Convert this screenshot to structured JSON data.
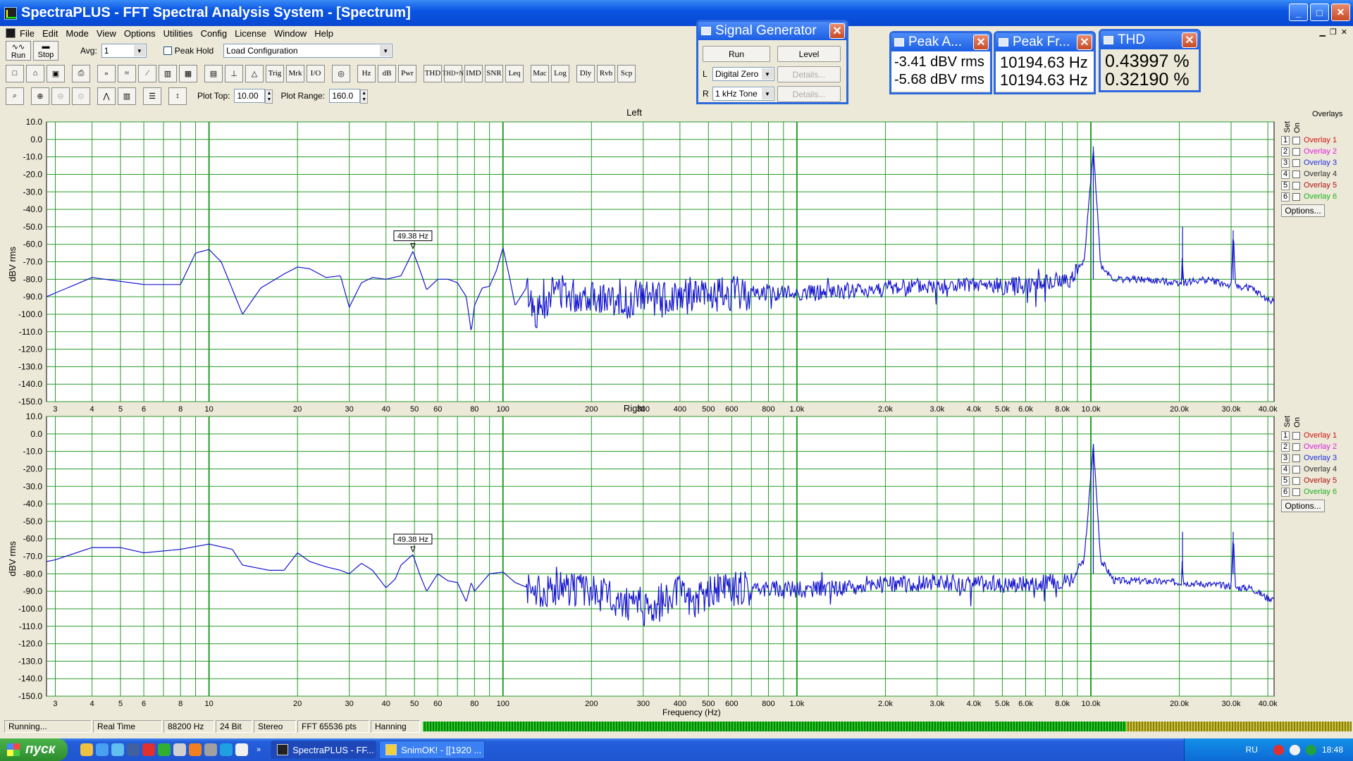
{
  "window": {
    "title": "SpectraPLUS - FFT Spectral Analysis System - [Spectrum]"
  },
  "menu": [
    "File",
    "Edit",
    "Mode",
    "View",
    "Options",
    "Utilities",
    "Config",
    "License",
    "Window",
    "Help"
  ],
  "toolbar1": {
    "run_label": "Run",
    "stop_label": "Stop",
    "avg_label": "Avg:",
    "avg_value": "1",
    "peak_hold_label": "Peak Hold",
    "config_value": "Load Configuration"
  },
  "toolbar2": [
    "Hz",
    "dB",
    "Pwr",
    "THD",
    "THD+N",
    "IMD",
    "SNR",
    "Leq",
    "Mac",
    "Log",
    "Dly",
    "Rvb",
    "Scp"
  ],
  "toolbar3": {
    "plot_top_label": "Plot Top:",
    "plot_top_value": "10.00",
    "plot_range_label": "Plot Range:",
    "plot_range_value": "160.0"
  },
  "signal_generator": {
    "title": "Signal Generator",
    "run": "Run",
    "level": "Level",
    "left_label": "L",
    "left_value": "Digital Zero",
    "right_label": "R",
    "right_value": "1 kHz Tone",
    "details": "Details..."
  },
  "peak_amplitude": {
    "title": "Peak A...",
    "line1": "-3.41 dBV rms",
    "line2": "-5.68 dBV rms"
  },
  "peak_frequency": {
    "title": "Peak Fr...",
    "line1": "10194.63 Hz",
    "line2": "10194.63 Hz"
  },
  "thd": {
    "title": "THD",
    "line1": "0.43997 %",
    "line2": "0.32190 %"
  },
  "plots": [
    {
      "title": "Left",
      "ylabel": "dBV rms",
      "marker": "49.38 Hz"
    },
    {
      "title": "Right",
      "ylabel": "dBV rms",
      "marker": "49.38 Hz"
    }
  ],
  "xlabel": "Frequency (Hz)",
  "overlays": {
    "header": "Overlays",
    "set_label": "Set",
    "on_label": "On",
    "options": "Options...",
    "items": [
      {
        "num": "1",
        "label": "Overlay 1",
        "color": "#d01010"
      },
      {
        "num": "2",
        "label": "Overlay 2",
        "color": "#e020e0"
      },
      {
        "num": "3",
        "label": "Overlay 3",
        "color": "#2030e0"
      },
      {
        "num": "4",
        "label": "Overlay 4",
        "color": "#303030"
      },
      {
        "num": "5",
        "label": "Overlay 5",
        "color": "#b01010"
      },
      {
        "num": "6",
        "label": "Overlay 6",
        "color": "#20b020"
      }
    ]
  },
  "chart_data": [
    {
      "type": "line",
      "title": "Left",
      "xlabel": "Frequency (Hz)",
      "ylabel": "dBV rms",
      "xscale": "log",
      "xlim": [
        2.8,
        42000
      ],
      "ylim": [
        -150,
        10
      ],
      "yticks": [
        "10.0",
        "0.0",
        "-10.0",
        "-20.0",
        "-30.0",
        "-40.0",
        "-50.0",
        "-60.0",
        "-70.0",
        "-80.0",
        "-90.0",
        "-100.0",
        "-110.0",
        "-120.0",
        "-130.0",
        "-140.0",
        "-150.0"
      ],
      "xticks": [
        "3",
        "4",
        "5",
        "6",
        "8",
        "10",
        "20",
        "30",
        "40",
        "50",
        "60",
        "80",
        "100",
        "200",
        "300",
        "400",
        "500",
        "600",
        "800",
        "1.0k",
        "2.0k",
        "3.0k",
        "4.0k",
        "5.0k",
        "6.0k",
        "8.0k",
        "10.0k",
        "20.0k",
        "30.0k",
        "40.0k"
      ],
      "series": [
        {
          "color": "#1515d0",
          "points": [
            [
              2.8,
              -90
            ],
            [
              4,
              -79
            ],
            [
              6,
              -83
            ],
            [
              8,
              -83
            ],
            [
              9,
              -65
            ],
            [
              10,
              -63
            ],
            [
              11,
              -70
            ],
            [
              13,
              -100
            ],
            [
              15,
              -85
            ],
            [
              18,
              -77
            ],
            [
              20,
              -73
            ],
            [
              22,
              -74
            ],
            [
              25,
              -79
            ],
            [
              28,
              -78
            ],
            [
              30,
              -96
            ],
            [
              33,
              -82
            ],
            [
              36,
              -79
            ],
            [
              40,
              -80
            ],
            [
              45,
              -78
            ],
            [
              49.4,
              -64
            ],
            [
              52,
              -74
            ],
            [
              55,
              -86
            ],
            [
              60,
              -80
            ],
            [
              65,
              -80
            ],
            [
              70,
              -82
            ],
            [
              75,
              -90
            ],
            [
              78,
              -110
            ],
            [
              80,
              -95
            ],
            [
              85,
              -85
            ],
            [
              90,
              -84
            ],
            [
              95,
              -75
            ],
            [
              100,
              -62
            ],
            [
              105,
              -78
            ],
            [
              110,
              -95
            ],
            [
              120,
              -85
            ],
            [
              130,
              -100
            ],
            [
              150,
              -85
            ],
            [
              180,
              -90
            ],
            [
              200,
              -88
            ],
            [
              250,
              -95
            ],
            [
              300,
              -90
            ],
            [
              350,
              -92
            ],
            [
              400,
              -88
            ],
            [
              450,
              -89
            ],
            [
              500,
              -90
            ],
            [
              600,
              -88
            ],
            [
              800,
              -88
            ],
            [
              1000,
              -88
            ],
            [
              1500,
              -87
            ],
            [
              2000,
              -85
            ],
            [
              3000,
              -84
            ],
            [
              5000,
              -84
            ],
            [
              7000,
              -82
            ],
            [
              8500,
              -80
            ],
            [
              9500,
              -70
            ],
            [
              10194,
              -4
            ],
            [
              10800,
              -72
            ],
            [
              12000,
              -80
            ],
            [
              14000,
              -80
            ],
            [
              20400,
              -82
            ],
            [
              20500,
              -50
            ],
            [
              20600,
              -82
            ],
            [
              25000,
              -80
            ],
            [
              30000,
              -84
            ],
            [
              30500,
              -52
            ],
            [
              31000,
              -84
            ],
            [
              35000,
              -85
            ],
            [
              40000,
              -92
            ]
          ]
        }
      ]
    },
    {
      "type": "line",
      "title": "Right",
      "xlabel": "Frequency (Hz)",
      "ylabel": "dBV rms",
      "xscale": "log",
      "xlim": [
        2.8,
        42000
      ],
      "ylim": [
        -150,
        10
      ],
      "yticks": [
        "10.0",
        "0.0",
        "-10.0",
        "-20.0",
        "-30.0",
        "-40.0",
        "-50.0",
        "-60.0",
        "-70.0",
        "-80.0",
        "-90.0",
        "-100.0",
        "-110.0",
        "-120.0",
        "-130.0",
        "-140.0",
        "-150.0"
      ],
      "xticks": [
        "3",
        "4",
        "5",
        "6",
        "8",
        "10",
        "20",
        "30",
        "40",
        "50",
        "60",
        "80",
        "100",
        "200",
        "300",
        "400",
        "500",
        "600",
        "800",
        "1.0k",
        "2.0k",
        "3.0k",
        "4.0k",
        "5.0k",
        "6.0k",
        "8.0k",
        "10.0k",
        "20.0k",
        "30.0k",
        "40.0k"
      ],
      "series": [
        {
          "color": "#1515d0",
          "points": [
            [
              2.8,
              -73
            ],
            [
              3,
              -72
            ],
            [
              4,
              -65
            ],
            [
              5,
              -65
            ],
            [
              6,
              -68
            ],
            [
              8,
              -66
            ],
            [
              10,
              -63
            ],
            [
              12,
              -66
            ],
            [
              13,
              -75
            ],
            [
              16,
              -78
            ],
            [
              18,
              -78
            ],
            [
              20,
              -68
            ],
            [
              22,
              -73
            ],
            [
              25,
              -76
            ],
            [
              28,
              -78
            ],
            [
              30,
              -80
            ],
            [
              33,
              -74
            ],
            [
              36,
              -78
            ],
            [
              40,
              -88
            ],
            [
              43,
              -83
            ],
            [
              45,
              -75
            ],
            [
              49.4,
              -69
            ],
            [
              52,
              -80
            ],
            [
              55,
              -90
            ],
            [
              60,
              -80
            ],
            [
              65,
              -84
            ],
            [
              70,
              -85
            ],
            [
              75,
              -96
            ],
            [
              78,
              -85
            ],
            [
              80,
              -90
            ],
            [
              90,
              -80
            ],
            [
              100,
              -79
            ],
            [
              110,
              -85
            ],
            [
              130,
              -90
            ],
            [
              150,
              -88
            ],
            [
              200,
              -90
            ],
            [
              250,
              -95
            ],
            [
              300,
              -100
            ],
            [
              350,
              -95
            ],
            [
              400,
              -90
            ],
            [
              450,
              -96
            ],
            [
              500,
              -90
            ],
            [
              600,
              -89
            ],
            [
              800,
              -88
            ],
            [
              1000,
              -89
            ],
            [
              1500,
              -88
            ],
            [
              2000,
              -86
            ],
            [
              3000,
              -85
            ],
            [
              5000,
              -86
            ],
            [
              7000,
              -85
            ],
            [
              8500,
              -83
            ],
            [
              9500,
              -72
            ],
            [
              10194,
              -6
            ],
            [
              10800,
              -72
            ],
            [
              12000,
              -84
            ],
            [
              14000,
              -84
            ],
            [
              20400,
              -85
            ],
            [
              20500,
              -56
            ],
            [
              20600,
              -85
            ],
            [
              25000,
              -86
            ],
            [
              30000,
              -87
            ],
            [
              30500,
              -56
            ],
            [
              31000,
              -88
            ],
            [
              35000,
              -88
            ],
            [
              40000,
              -94
            ]
          ]
        }
      ]
    }
  ],
  "status": {
    "state": "Running...",
    "mode": "Real Time",
    "rate": "88200 Hz",
    "bits": "24 Bit",
    "channels": "Stereo",
    "fft": "FFT 65536 pts",
    "window": "Hanning"
  },
  "taskbar": {
    "start": "пуск",
    "task1": "SpectraPLUS - FF...",
    "task2": "SnimOK! - [[1920 ...",
    "lang": "RU",
    "clock": "18:48"
  }
}
